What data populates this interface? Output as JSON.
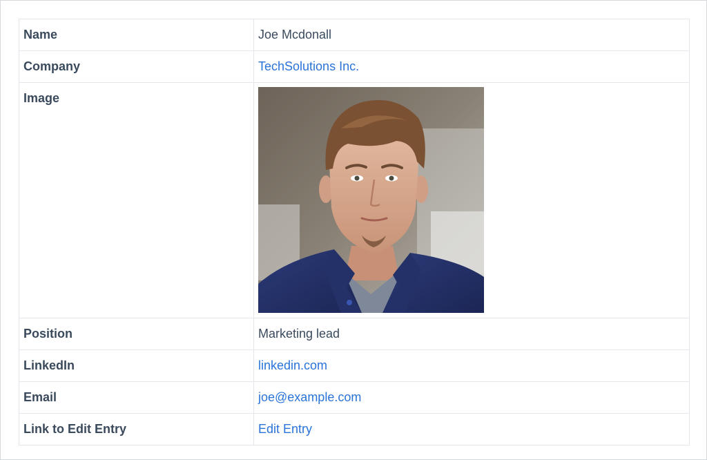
{
  "entry": {
    "name_label": "Name",
    "name_value": "Joe Mcdonall",
    "company_label": "Company",
    "company_value": "TechSolutions Inc.",
    "image_label": "Image",
    "image_alt": "Portrait photo of Joe Mcdonall",
    "position_label": "Position",
    "position_value": "Marketing lead",
    "linkedin_label": "LinkedIn",
    "linkedin_value": "linkedin.com",
    "email_label": "Email",
    "email_value": "joe@example.com",
    "edit_label": "Link to Edit Entry",
    "edit_value": "Edit Entry"
  },
  "colors": {
    "link": "#2a73d8",
    "label_text": "#38475a",
    "border": "#e3e6ea"
  }
}
